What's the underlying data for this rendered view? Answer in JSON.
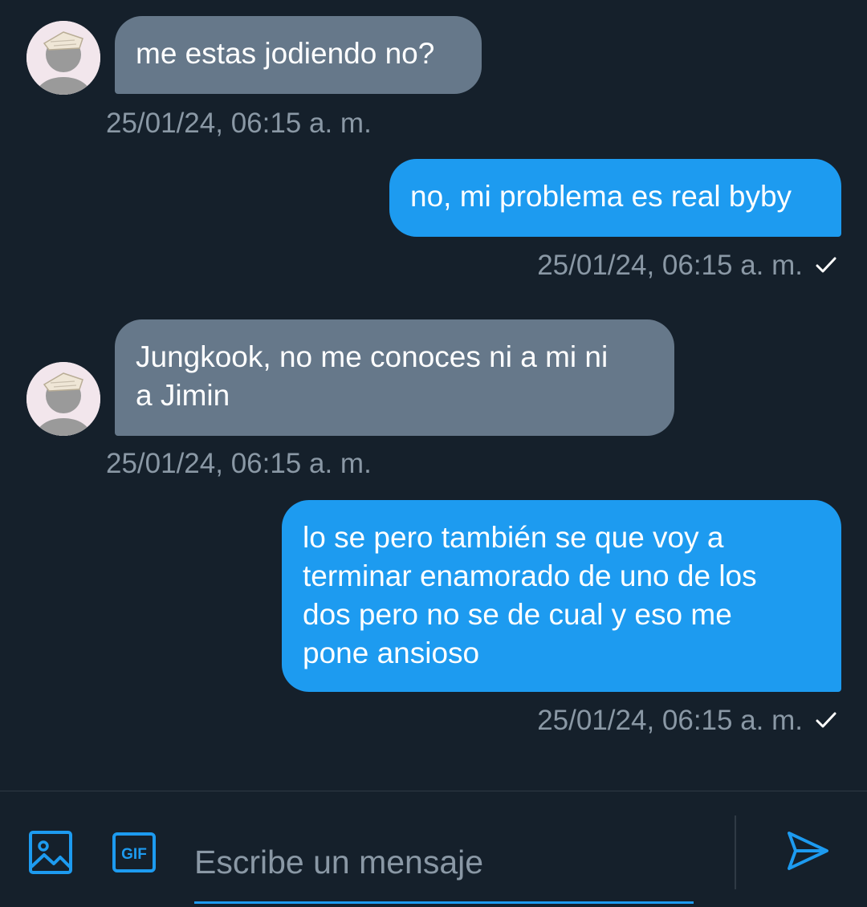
{
  "colors": {
    "background": "#15202b",
    "incoming_bubble": "#66788a",
    "outgoing_bubble": "#1d9bf0",
    "timestamp": "#8a98a5",
    "accent": "#1d9bf0"
  },
  "messages": [
    {
      "direction": "incoming",
      "text": "me estas jodiendo no?",
      "timestamp": "25/01/24, 06:15 a. m."
    },
    {
      "direction": "outgoing",
      "text": "no, mi problema es real byby",
      "timestamp": "25/01/24, 06:15 a. m.",
      "status_icon": "check-icon"
    },
    {
      "direction": "incoming",
      "text": "Jungkook, no me conoces ni a mi ni\na Jimin",
      "timestamp": "25/01/24, 06:15 a. m."
    },
    {
      "direction": "outgoing",
      "text": "lo se pero también se que voy a\nterminar enamorado de uno de los\ndos pero no se de cual y eso me\npone ansioso",
      "timestamp": "25/01/24, 06:15 a. m.",
      "status_icon": "check-icon"
    }
  ],
  "composer": {
    "image_button_icon": "image-icon",
    "gif_button_label": "GIF",
    "input_placeholder": "Escribe un mensaje",
    "input_value": "",
    "send_button_icon": "send-icon"
  }
}
